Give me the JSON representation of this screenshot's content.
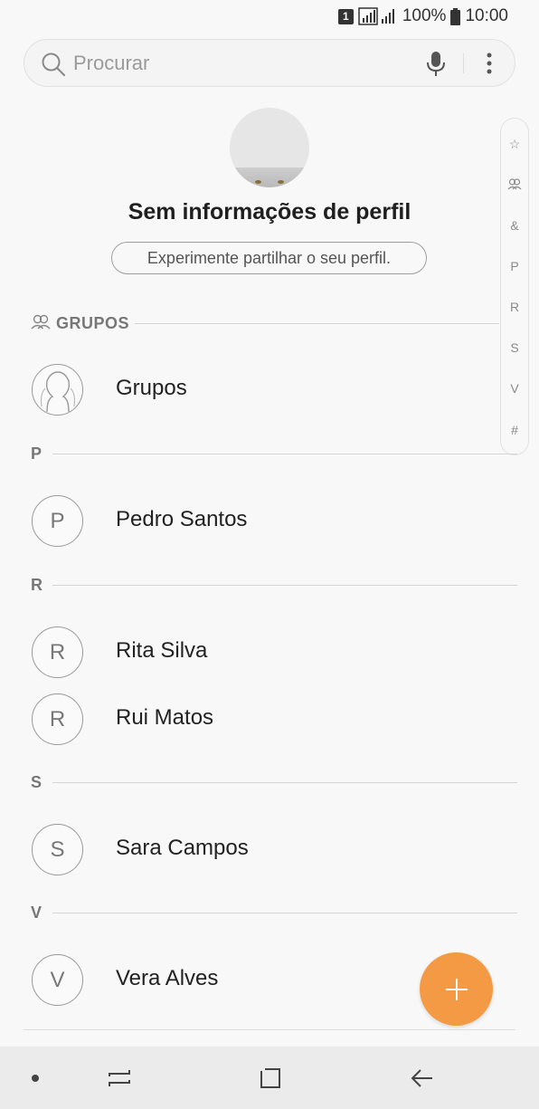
{
  "status_bar": {
    "sim": "1",
    "battery": "100%",
    "time": "10:00"
  },
  "search": {
    "placeholder": "Procurar"
  },
  "profile": {
    "title": "Sem informações de perfil",
    "share_label": "Experimente partilhar o seu perfil."
  },
  "index": [
    "☆",
    "GROUP",
    "&",
    "P",
    "R",
    "S",
    "V",
    "#"
  ],
  "groups_section": {
    "header": "GRUPOS",
    "item_label": "Grupos"
  },
  "sections": [
    {
      "letter": "P",
      "contacts": [
        {
          "initial": "P",
          "name": "Pedro Santos"
        }
      ]
    },
    {
      "letter": "R",
      "contacts": [
        {
          "initial": "R",
          "name": "Rita Silva"
        },
        {
          "initial": "R",
          "name": "Rui Matos"
        }
      ]
    },
    {
      "letter": "S",
      "contacts": [
        {
          "initial": "S",
          "name": "Sara Campos"
        }
      ]
    },
    {
      "letter": "V",
      "contacts": [
        {
          "initial": "V",
          "name": "Vera Alves"
        }
      ]
    }
  ],
  "colors": {
    "fab": "#f59a44",
    "background": "#f8f8f8"
  },
  "icons": {
    "search": "search-icon",
    "mic": "mic-icon",
    "more": "more-vert-icon",
    "add": "plus-icon",
    "groups": "groups-icon",
    "back": "back-arrow-icon",
    "home": "home-square-icon",
    "recent": "recent-apps-icon"
  }
}
